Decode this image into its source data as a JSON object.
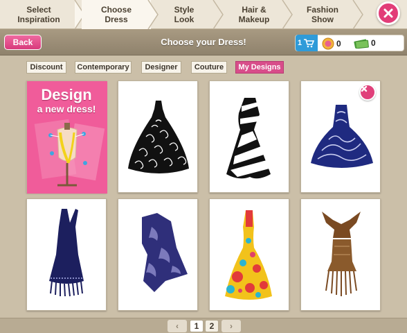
{
  "steps": [
    {
      "line1": "Select",
      "line2": "Inspiration"
    },
    {
      "line1": "Choose",
      "line2": "Dress"
    },
    {
      "line1": "Style",
      "line2": "Look"
    },
    {
      "line1": "Hair &",
      "line2": "Makeup"
    },
    {
      "line1": "Fashion",
      "line2": "Show"
    }
  ],
  "header": {
    "back_label": "Back",
    "title": "Choose your Dress!",
    "cart_count": "1",
    "coins": "0",
    "cash": "0"
  },
  "tabs": [
    "Discount",
    "Contemporary",
    "Designer",
    "Couture",
    "My Designs"
  ],
  "active_tab": "My Designs",
  "design_card": {
    "line1": "Design",
    "line2": "a new dress!"
  },
  "dresses": [
    {
      "icon": "black-lace-ballgown-icon",
      "colors": [
        "#111111",
        "#ffffff"
      ]
    },
    {
      "icon": "black-white-stripe-dress-icon",
      "colors": [
        "#111111",
        "#ffffff"
      ]
    },
    {
      "icon": "navy-swirl-dress-icon",
      "colors": [
        "#1f2a80",
        "#ffffff"
      ],
      "removable": true
    },
    {
      "icon": "navy-fringe-dress-icon",
      "colors": [
        "#1c1f5e"
      ]
    },
    {
      "icon": "purple-tiedye-dress-icon",
      "colors": [
        "#2f2f7a",
        "#8a88c8"
      ]
    },
    {
      "icon": "colorful-gown-icon",
      "colors": [
        "#f2c21b",
        "#e23a3a",
        "#2ab4d0"
      ]
    },
    {
      "icon": "brown-fringe-dress-icon",
      "colors": [
        "#7a4a22",
        "#a87a4a"
      ]
    }
  ],
  "pager": {
    "prev": "‹",
    "pages": [
      "1",
      "2"
    ],
    "current": "1",
    "next": "›"
  },
  "colors": {
    "accent": "#e23d78",
    "tab_active": "#d84d8a",
    "cart": "#2f9bd9"
  }
}
